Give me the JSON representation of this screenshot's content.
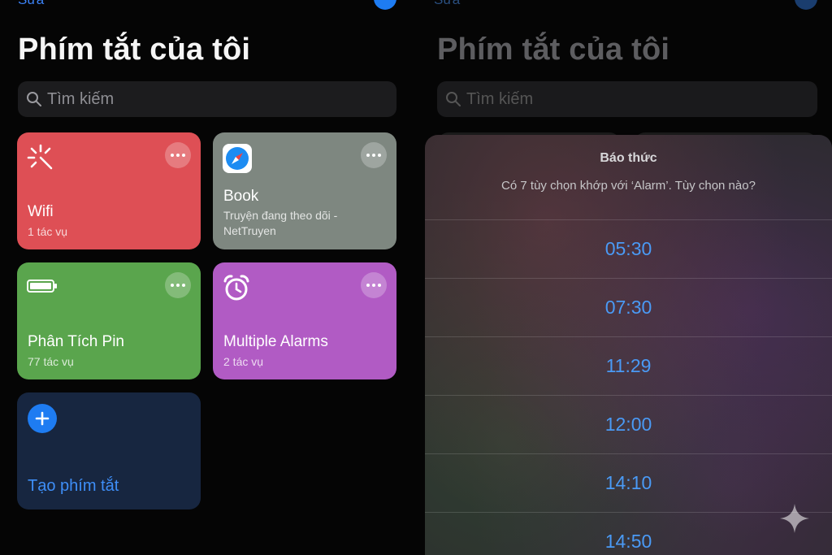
{
  "left": {
    "edit_link": "Sửa",
    "title": "Phím tắt của tôi",
    "search": {
      "placeholder": "Tìm kiếm"
    },
    "tiles": [
      {
        "title": "Wifi",
        "subtitle": "1 tác vụ",
        "color": "#de4f55",
        "icon": "wifi-sparkle-icon"
      },
      {
        "title": "Book",
        "subtitle": "Truyện đang theo dõi - NetTruyen",
        "color": "#7e8780",
        "icon": "safari-icon"
      },
      {
        "title": "Phân Tích Pin",
        "subtitle": "77 tác vụ",
        "color": "#5aa54d",
        "icon": "battery-icon"
      },
      {
        "title": "Multiple Alarms",
        "subtitle": "2 tác vụ",
        "color": "#b15bc4",
        "icon": "alarm-clock-icon"
      }
    ],
    "create_label": "Tạo phím tắt"
  },
  "right": {
    "edit_link": "Sửa",
    "title": "Phím tắt của tôi",
    "search": {
      "placeholder": "Tìm kiếm"
    },
    "sheet": {
      "title": "Báo thức",
      "message": "Có 7 tùy chọn khớp với ‘Alarm’. Tùy chọn nào?",
      "options": [
        "05:30",
        "07:30",
        "11:29",
        "12:00",
        "14:10",
        "14:50"
      ]
    }
  },
  "colors": {
    "accent": "#1e7cf2",
    "option_text": "#4a9af5"
  }
}
